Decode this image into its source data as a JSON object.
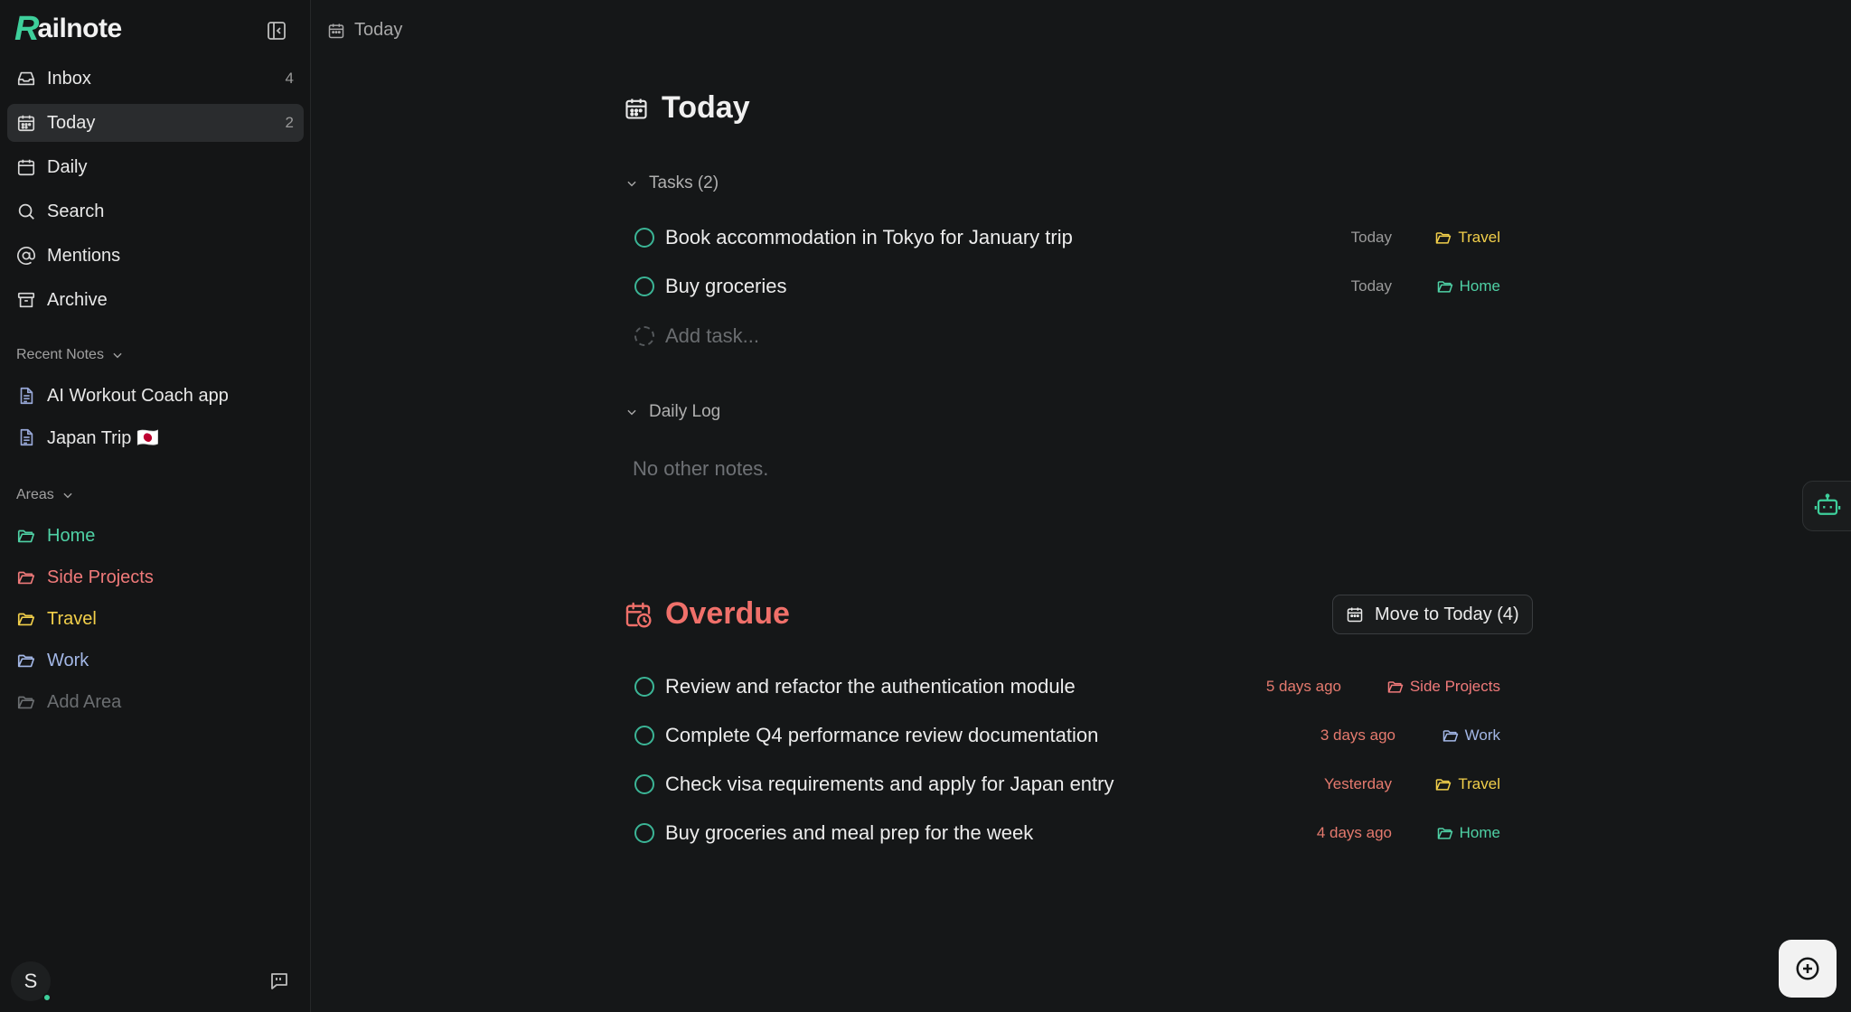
{
  "app": {
    "logo_initial": "R",
    "logo_rest": "ailnote"
  },
  "sidebar": {
    "nav": [
      {
        "label": "Inbox",
        "count": "4",
        "icon": "inbox-icon"
      },
      {
        "label": "Today",
        "count": "2",
        "icon": "calendar-today-icon",
        "active": true
      },
      {
        "label": "Daily",
        "count": "",
        "icon": "calendar-icon"
      },
      {
        "label": "Search",
        "count": "",
        "icon": "search-icon"
      },
      {
        "label": "Mentions",
        "count": "",
        "icon": "at-icon"
      },
      {
        "label": "Archive",
        "count": "",
        "icon": "archive-icon"
      }
    ],
    "recent_header": "Recent Notes",
    "recent_notes": [
      {
        "label": "AI Workout Coach app"
      },
      {
        "label": "Japan Trip 🇯🇵"
      }
    ],
    "areas_header": "Areas",
    "areas": [
      {
        "label": "Home",
        "color": "#4fd1a5"
      },
      {
        "label": "Side Projects",
        "color": "#f07a7a"
      },
      {
        "label": "Travel",
        "color": "#f2cf4a"
      },
      {
        "label": "Work",
        "color": "#a3b7e6"
      }
    ],
    "add_area_label": "Add Area",
    "user_initial": "S"
  },
  "topbar": {
    "breadcrumb": "Today"
  },
  "today": {
    "title": "Today",
    "tasks_header": "Tasks (2)",
    "tasks": [
      {
        "title": "Book accommodation in Tokyo for January trip",
        "date": "Today",
        "area": "Travel",
        "area_color": "#f2cf4a"
      },
      {
        "title": "Buy groceries",
        "date": "Today",
        "area": "Home",
        "area_color": "#4fd1a5"
      }
    ],
    "add_task_placeholder": "Add task...",
    "daily_log_header": "Daily Log",
    "empty_text": "No other notes."
  },
  "overdue": {
    "title": "Overdue",
    "move_button": "Move to Today (4)",
    "tasks": [
      {
        "title": "Review and refactor the authentication module",
        "date": "5 days ago",
        "area": "Side Projects",
        "area_color": "#f07a7a"
      },
      {
        "title": "Complete Q4 performance review documentation",
        "date": "3 days ago",
        "area": "Work",
        "area_color": "#a3b7e6"
      },
      {
        "title": "Check visa requirements and apply for Japan entry",
        "date": "Yesterday",
        "area": "Travel",
        "area_color": "#f2cf4a"
      },
      {
        "title": "Buy groceries and meal prep for the week",
        "date": "4 days ago",
        "area": "Home",
        "area_color": "#4fd1a5"
      }
    ]
  },
  "colors": {
    "accent": "#3ecf9b",
    "overdue": "#f0706a",
    "date_today": "#9a9a9a",
    "date_overdue": "#e57a6e"
  }
}
